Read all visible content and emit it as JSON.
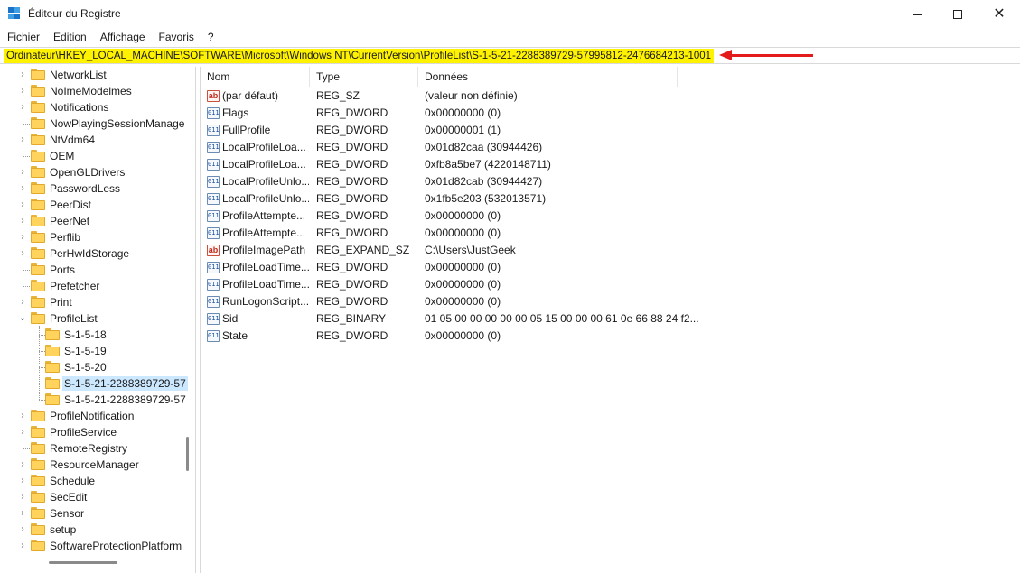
{
  "window": {
    "title": "Éditeur du Registre",
    "icon": "registry-editor-icon",
    "controls": [
      "minimize-icon",
      "maximize-icon",
      "close-icon"
    ]
  },
  "menu": [
    "Fichier",
    "Edition",
    "Affichage",
    "Favoris",
    "?"
  ],
  "address": {
    "path": "Ordinateur\\HKEY_LOCAL_MACHINE\\SOFTWARE\\Microsoft\\Windows NT\\CurrentVersion\\ProfileList\\S-1-5-21-2288389729-57995812-2476684213-1001",
    "highlight_color": "#fff200",
    "annotation_arrow_color": "#e31b1b"
  },
  "tree": {
    "items": [
      {
        "label": "NetworkList",
        "expandable": true
      },
      {
        "label": "NoImeModelmes",
        "expandable": true
      },
      {
        "label": "Notifications",
        "expandable": true
      },
      {
        "label": "NowPlayingSessionManage",
        "expandable": false
      },
      {
        "label": "NtVdm64",
        "expandable": true
      },
      {
        "label": "OEM",
        "expandable": false
      },
      {
        "label": "OpenGLDrivers",
        "expandable": true
      },
      {
        "label": "PasswordLess",
        "expandable": true
      },
      {
        "label": "PeerDist",
        "expandable": true
      },
      {
        "label": "PeerNet",
        "expandable": true
      },
      {
        "label": "Perflib",
        "expandable": true
      },
      {
        "label": "PerHwIdStorage",
        "expandable": true
      },
      {
        "label": "Ports",
        "expandable": false
      },
      {
        "label": "Prefetcher",
        "expandable": false
      },
      {
        "label": "Print",
        "expandable": true
      },
      {
        "label": "ProfileList",
        "expandable": true,
        "expanded": true
      },
      {
        "label": "S-1-5-18",
        "child": true
      },
      {
        "label": "S-1-5-19",
        "child": true
      },
      {
        "label": "S-1-5-20",
        "child": true
      },
      {
        "label": "S-1-5-21-2288389729-57",
        "child": true,
        "selected": true
      },
      {
        "label": "S-1-5-21-2288389729-57",
        "child": true
      },
      {
        "label": "ProfileNotification",
        "expandable": true
      },
      {
        "label": "ProfileService",
        "expandable": true
      },
      {
        "label": "RemoteRegistry",
        "expandable": false
      },
      {
        "label": "ResourceManager",
        "expandable": true
      },
      {
        "label": "Schedule",
        "expandable": true
      },
      {
        "label": "SecEdit",
        "expandable": true
      },
      {
        "label": "Sensor",
        "expandable": true
      },
      {
        "label": "setup",
        "expandable": true
      },
      {
        "label": "SoftwareProtectionPlatform",
        "expandable": true
      }
    ]
  },
  "columns": {
    "name": "Nom",
    "type": "Type",
    "data": "Données"
  },
  "values": [
    {
      "name": "(par défaut)",
      "type": "REG_SZ",
      "data": "(valeur non définie)",
      "icon": "string-value-icon"
    },
    {
      "name": "Flags",
      "type": "REG_DWORD",
      "data": "0x00000000 (0)",
      "icon": "binary-value-icon"
    },
    {
      "name": "FullProfile",
      "type": "REG_DWORD",
      "data": "0x00000001 (1)",
      "icon": "binary-value-icon"
    },
    {
      "name": "LocalProfileLoa...",
      "type": "REG_DWORD",
      "data": "0x01d82caa (30944426)",
      "icon": "binary-value-icon"
    },
    {
      "name": "LocalProfileLoa...",
      "type": "REG_DWORD",
      "data": "0xfb8a5be7 (4220148711)",
      "icon": "binary-value-icon"
    },
    {
      "name": "LocalProfileUnlo...",
      "type": "REG_DWORD",
      "data": "0x01d82cab (30944427)",
      "icon": "binary-value-icon"
    },
    {
      "name": "LocalProfileUnlo...",
      "type": "REG_DWORD",
      "data": "0x1fb5e203 (532013571)",
      "icon": "binary-value-icon"
    },
    {
      "name": "ProfileAttempte...",
      "type": "REG_DWORD",
      "data": "0x00000000 (0)",
      "icon": "binary-value-icon"
    },
    {
      "name": "ProfileAttempte...",
      "type": "REG_DWORD",
      "data": "0x00000000 (0)",
      "icon": "binary-value-icon"
    },
    {
      "name": "ProfileImagePath",
      "type": "REG_EXPAND_SZ",
      "data": "C:\\Users\\JustGeek",
      "icon": "string-value-icon"
    },
    {
      "name": "ProfileLoadTime...",
      "type": "REG_DWORD",
      "data": "0x00000000 (0)",
      "icon": "binary-value-icon"
    },
    {
      "name": "ProfileLoadTime...",
      "type": "REG_DWORD",
      "data": "0x00000000 (0)",
      "icon": "binary-value-icon"
    },
    {
      "name": "RunLogonScript...",
      "type": "REG_DWORD",
      "data": "0x00000000 (0)",
      "icon": "binary-value-icon"
    },
    {
      "name": "Sid",
      "type": "REG_BINARY",
      "data": "01 05 00 00 00 00 00 05 15 00 00 00 61 0e 66 88 24 f2...",
      "icon": "binary-value-icon"
    },
    {
      "name": "State",
      "type": "REG_DWORD",
      "data": "0x00000000 (0)",
      "icon": "binary-value-icon"
    }
  ]
}
